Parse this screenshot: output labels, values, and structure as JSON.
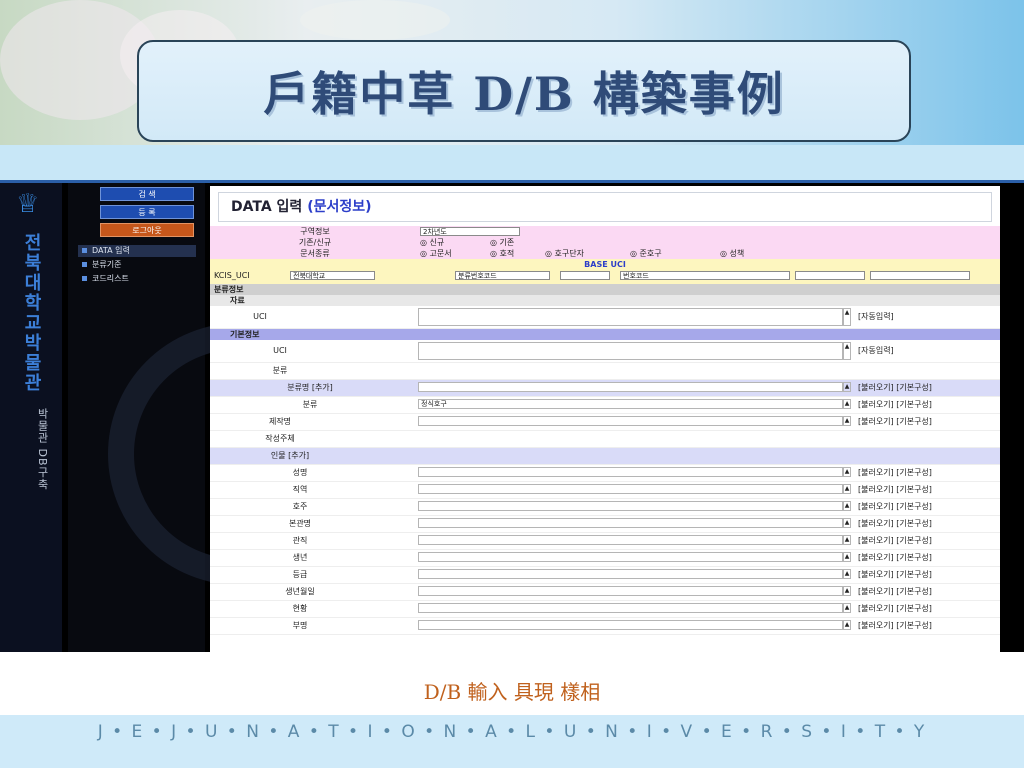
{
  "slide": {
    "title": "戶籍中草 D/B 構築事例",
    "caption": "D/B 輸入 具現 樣相",
    "footer": "J • E • J • U • N • A • T • I • O • N • A • L • U • N • I • V • E • R • S • I • T • Y"
  },
  "sidebar": {
    "strip_title": "전북대학교박물관",
    "strip_sub": "박물관 DB구축",
    "buttons": [
      "검 색",
      "등 록",
      "로그아웃"
    ],
    "items": [
      "DATA 입력",
      "분류기준",
      "코드리스트"
    ]
  },
  "form": {
    "title": "DATA 입력",
    "title_sub": "(문서정보)",
    "rows": [
      {
        "label": "구역정보",
        "value": "2차년도"
      },
      {
        "label": "기존/신규",
        "options": [
          "신규",
          "기존"
        ]
      },
      {
        "label": "문서종류",
        "options": [
          "고문서",
          "호적",
          "호구단자",
          "준호구",
          "성책"
        ]
      }
    ],
    "base_uci": "BASE UCI",
    "uci_prefix": "KCIS_UCI",
    "uci_select1": "전북대학교",
    "uci_select2": "분류번호코드",
    "uci_select3": "번호코드",
    "section_main": "분류정보",
    "section_sub": "자료",
    "group_basic": "기본정보",
    "table": [
      {
        "label": "UCI",
        "value": "",
        "actions": "[자동입력]",
        "big": true
      },
      {
        "label": "UCI",
        "value": "",
        "actions": "[자동입력]",
        "big": true
      },
      {
        "label": "분류",
        "value": "",
        "actions": ""
      },
      {
        "label": "분류명 [추가]",
        "value": "",
        "actions": "[불러오기] [기본구성]"
      },
      {
        "label": "분류",
        "value": "정식호구",
        "actions": "[불러오기] [기본구성]"
      },
      {
        "label": "제작명",
        "value": "",
        "actions": "[불러오기] [기본구성]"
      },
      {
        "label": "작성주체",
        "value": "",
        "actions": ""
      },
      {
        "label": "인물 [추가]",
        "value": "",
        "actions": ""
      },
      {
        "label": "성명",
        "value": "",
        "actions": "[불러오기] [기본구성]"
      },
      {
        "label": "직역",
        "value": "",
        "actions": "[불러오기] [기본구성]"
      },
      {
        "label": "호주",
        "value": "",
        "actions": "[불러오기] [기본구성]"
      },
      {
        "label": "본관명",
        "value": "",
        "actions": "[불러오기] [기본구성]"
      },
      {
        "label": "관직",
        "value": "",
        "actions": "[불러오기] [기본구성]"
      },
      {
        "label": "생년",
        "value": "",
        "actions": "[불러오기] [기본구성]"
      },
      {
        "label": "등급",
        "value": "",
        "actions": "[불러오기] [기본구성]"
      },
      {
        "label": "생년월일",
        "value": "",
        "actions": "[불러오기] [기본구성]"
      },
      {
        "label": "현황",
        "value": "",
        "actions": "[불러오기] [기본구성]"
      },
      {
        "label": "부명",
        "value": "",
        "actions": "[불러오기] [기본구성]"
      }
    ]
  },
  "colors": {
    "accent": "#2c3ec9",
    "pink": "#fbd9f3",
    "yellow": "#fdf6bf",
    "lavender": "#a6a8ea",
    "orange": "#c6571b"
  }
}
